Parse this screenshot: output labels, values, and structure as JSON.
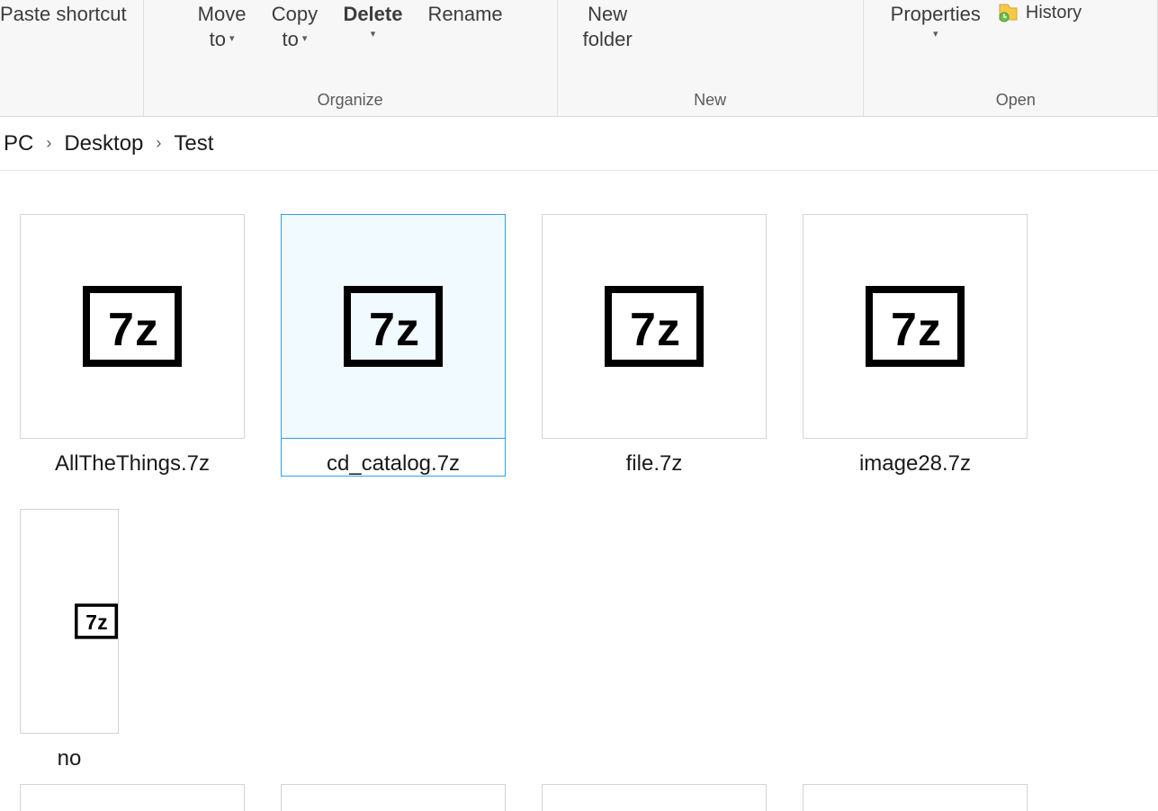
{
  "ribbon": {
    "clipboard": {
      "paste_shortcut": "Paste shortcut"
    },
    "organize": {
      "label": "Organize",
      "move_to_l1": "Move",
      "move_to_l2": "to",
      "copy_to_l1": "Copy",
      "copy_to_l2": "to",
      "delete": "Delete",
      "rename": "Rename"
    },
    "new": {
      "label": "New",
      "new_folder_l1": "New",
      "new_folder_l2": "folder"
    },
    "open": {
      "label": "Open",
      "properties": "Properties",
      "history": "History"
    }
  },
  "breadcrumb": {
    "root": "PC",
    "seg1": "Desktop",
    "seg2": "Test"
  },
  "files": {
    "f0": "AllTheThings.7z",
    "f1": "cd_catalog.7z",
    "f2": "file.7z",
    "f3": "image28.7z",
    "f4": "no"
  }
}
